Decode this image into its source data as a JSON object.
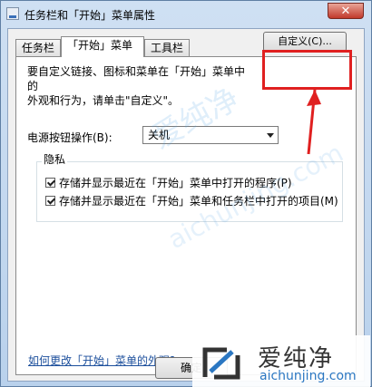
{
  "window": {
    "title": "任务栏和「开始」菜单属性",
    "close_glyph": "✕"
  },
  "tabs": [
    {
      "label": "任务栏"
    },
    {
      "label": "「开始」菜单"
    },
    {
      "label": "工具栏"
    }
  ],
  "panel": {
    "description_line1": "要自定义链接、图标和菜单在「开始」菜单中的",
    "description_line2": "外观和行为，请单击\"自定义\"。",
    "customize_button": "自定义(C)...",
    "power_label": "电源按钮操作(B):",
    "power_value": "关机",
    "privacy_title": "隐私",
    "privacy_items": [
      {
        "label": "存储并显示最近在「开始」菜单中打开的程序(P)",
        "checked": true
      },
      {
        "label": "存储并显示最近在「开始」菜单和任务栏中打开的项目(M)",
        "checked": true
      }
    ],
    "help_link": "如何更改「开始」菜单的外观?"
  },
  "footer": {
    "ok_button": "确定"
  },
  "watermark": {
    "brand": "爱纯净",
    "url": "aichunjing.com"
  },
  "colors": {
    "highlight": "#e02020",
    "link": "#1c4f9c",
    "brand_blue": "#2b77c2"
  }
}
